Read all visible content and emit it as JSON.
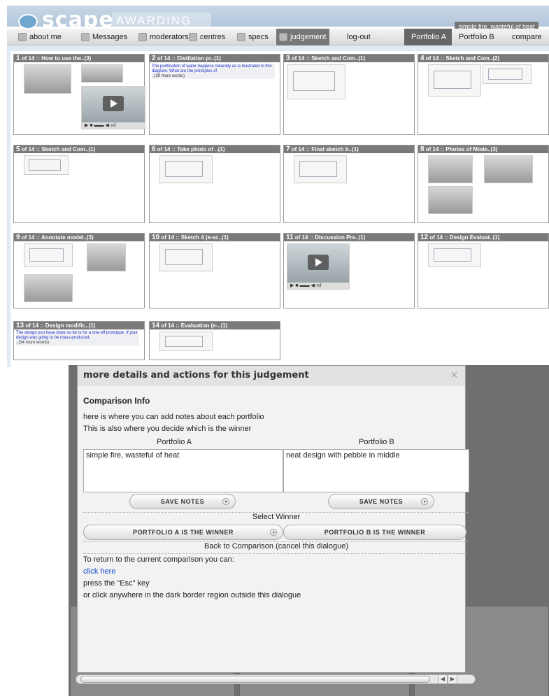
{
  "brand": {
    "logo": "scape",
    "subtitle": "AWARDING BODY",
    "notes_preview": "simple fire, wasteful of heat"
  },
  "nav": {
    "about_me": "about me",
    "messages": "Messages",
    "moderators": "moderators",
    "centres": "centres",
    "specs": "specs",
    "judgement": "judgement",
    "logout": "log-out",
    "portfolio_a": "Portfolio A",
    "portfolio_b": "Portfolio B",
    "compare": "compare"
  },
  "cards": [
    {
      "num": "1",
      "title": " of 14 :: How to use the..(3)"
    },
    {
      "num": "2",
      "title": " of 14 :: Distilation pr..(1)",
      "text": "The purification of water happens naturally as is illustrated in this diagram. What are the principles of",
      "more": "..(39 more words)"
    },
    {
      "num": "3",
      "title": " of 14 :: Sketch and Com..(1)"
    },
    {
      "num": "4",
      "title": " of 14 :: Sketch and Com..(2)"
    },
    {
      "num": "5",
      "title": " of 14 :: Sketch and Com..(1)"
    },
    {
      "num": "6",
      "title": " of 14 :: Take photo of ..(1)"
    },
    {
      "num": "7",
      "title": " of 14 :: Final sketch b..(1)"
    },
    {
      "num": "8",
      "title": " of 14 :: Photos of Mode..(3)"
    },
    {
      "num": "9",
      "title": " of 14 :: Annotate model..(3)"
    },
    {
      "num": "10",
      "title": " of 14 :: Sketch 4 (e-sc..(1)"
    },
    {
      "num": "11",
      "title": " of 14 :: Discussion Pre..(1)"
    },
    {
      "num": "12",
      "title": " of 14 :: Design Evaluat..(1)"
    },
    {
      "num": "13",
      "title": " of 14 :: Design modific..(1)",
      "text": "The design you have done so far is for a one-off prototype. If your design was going to be mass-produced,",
      "more": "..(34 more words)"
    },
    {
      "num": "14",
      "title": " of 14 :: Evaluation (e-..(1)"
    }
  ],
  "dialog": {
    "title": "more details and actions for this judgement",
    "close": "×",
    "heading": "Comparison Info",
    "line1": "here is where you can add notes about each portfolio",
    "line2": "This is also where you decide which is the winner",
    "portfolio_a_label": "Portfolio A",
    "portfolio_b_label": "Portfolio B",
    "notes_a": "simple fire, wasteful of heat",
    "notes_b": "neat design with pebble in middle",
    "save_notes": "SAVE NOTES",
    "select_winner": "Select Winner",
    "winner_a": "PORTFOLIO A IS THE WINNER",
    "winner_b": "PORTFOLIO B IS THE WINNER",
    "back": "Back to Comparison (cancel this dialogue)",
    "return_intro": "To return to the current comparison you can:",
    "click_here": "click here",
    "esc": "press the \"Esc\" key",
    "outside": "or click anywhere in the dark border region outside this dialogue"
  },
  "scroll": {
    "left": "◀",
    "right": "▶"
  }
}
